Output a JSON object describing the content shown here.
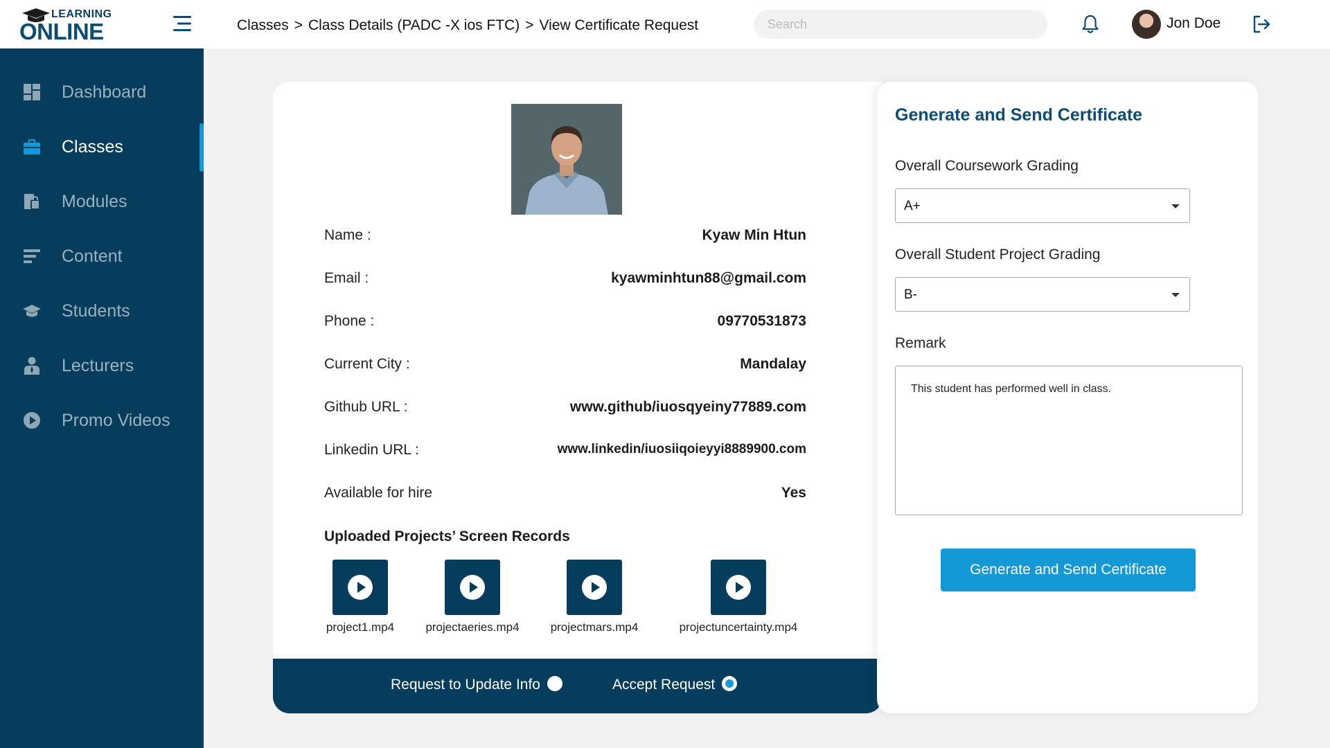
{
  "app": {
    "logo_top": "LEARNING",
    "logo_main": "ONLINE"
  },
  "header": {
    "breadcrumb": [
      "Classes",
      "Class Details (PADC -X ios FTC)",
      "View Certificate Request"
    ],
    "breadcrumb_separator": ">",
    "search_placeholder": "Search",
    "username": "Jon Doe"
  },
  "sidebar": {
    "items": [
      {
        "label": "Dashboard",
        "icon": "dashboard-icon",
        "active": false
      },
      {
        "label": "Classes",
        "icon": "briefcase-icon",
        "active": true
      },
      {
        "label": "Modules",
        "icon": "modules-icon",
        "active": false
      },
      {
        "label": "Content",
        "icon": "content-icon",
        "active": false
      },
      {
        "label": "Students",
        "icon": "graduation-cap-icon",
        "active": false
      },
      {
        "label": "Lecturers",
        "icon": "lecturer-icon",
        "active": false
      },
      {
        "label": "Promo Videos",
        "icon": "play-circle-icon",
        "active": false
      }
    ]
  },
  "student": {
    "fields": [
      {
        "key": "Name :",
        "value": "Kyaw Min Htun"
      },
      {
        "key": "Email :",
        "value": "kyawminhtun88@gmail.com"
      },
      {
        "key": "Phone :",
        "value": "09770531873"
      },
      {
        "key": "Current City :",
        "value": "Mandalay"
      },
      {
        "key": "Github URL :",
        "value": "www.github/iuosqyeiny77889.com"
      },
      {
        "key": "Linkedin URL :",
        "value": "www.linkedin/iuosiiqoieyyi8889900.com"
      },
      {
        "key": "Available for hire",
        "value": "Yes"
      }
    ],
    "projects_title": "Uploaded Projects’ Screen Records",
    "videos": [
      "project1.mp4",
      "projectaeries.mp4",
      "projectmars.mp4",
      "projectuncertainty.mp4"
    ]
  },
  "footer": {
    "option_update": "Request to Update Info",
    "option_accept": "Accept Request",
    "selected": "Accept Request"
  },
  "certificate": {
    "title": "Generate and Send Certificate",
    "coursework_label": "Overall Coursework Grading",
    "coursework_value": "A+",
    "project_label": "Overall Student Project Grading",
    "project_value": "B-",
    "remark_label": "Remark",
    "remark_value": "This student has performed well in class.",
    "button_label": "Generate and Send Certificate"
  },
  "colors": {
    "sidebar": "#063d5c",
    "accent": "#139ad6",
    "title": "#0a4c74",
    "background": "#f2f2f2"
  }
}
